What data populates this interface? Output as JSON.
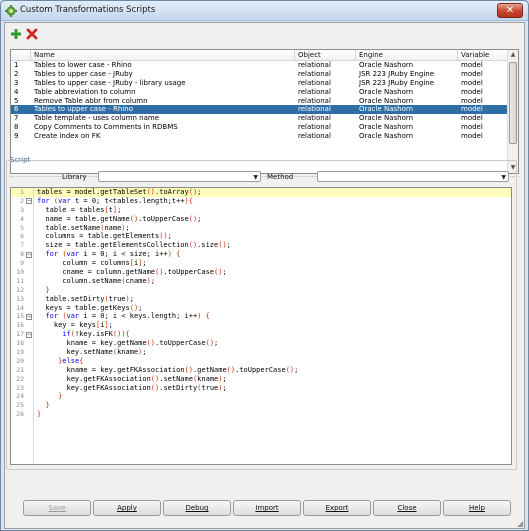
{
  "window": {
    "title": "Custom Transformations Scripts",
    "close_glyph": "✕"
  },
  "toolbar": {
    "add_icon": "plus-icon",
    "delete_icon": "x-icon",
    "add_color": "#2e9e2e",
    "delete_color": "#d2281e"
  },
  "table": {
    "columns": [
      "",
      "Name",
      "Object",
      "Engine",
      "Variable"
    ],
    "rows": [
      {
        "num": "1",
        "name": "Tables to lower case - Rhino",
        "object": "relational",
        "engine": "Oracle Nashorn",
        "variable": "model"
      },
      {
        "num": "2",
        "name": "Tables to upper case - JRuby",
        "object": "relational",
        "engine": "JSR 223 JRuby Engine",
        "variable": "model"
      },
      {
        "num": "3",
        "name": "Tables to upper case - JRuby - library usage",
        "object": "relational",
        "engine": "JSR 223 JRuby Engine",
        "variable": "model"
      },
      {
        "num": "4",
        "name": "Table abbreviation to column",
        "object": "relational",
        "engine": "Oracle Nashorn",
        "variable": "model"
      },
      {
        "num": "5",
        "name": "Remove Table abbr from column",
        "object": "relational",
        "engine": "Oracle Nashorn",
        "variable": "model"
      },
      {
        "num": "6",
        "name": "Tables to upper case - Rhino",
        "object": "relational",
        "engine": "Oracle Nashorn",
        "variable": "model",
        "selected": true
      },
      {
        "num": "7",
        "name": "Table template - uses column name",
        "object": "relational",
        "engine": "Oracle Nashorn",
        "variable": "model"
      },
      {
        "num": "8",
        "name": "Copy Comments to Comments in RDBMS",
        "object": "relational",
        "engine": "Oracle Nashorn",
        "variable": "model"
      },
      {
        "num": "9",
        "name": "Create index on FK",
        "object": "relational",
        "engine": "Oracle Nashorn",
        "variable": "model"
      }
    ],
    "selected_color": "#2f6ea5"
  },
  "script": {
    "group_label": "Script",
    "library_label": "Library",
    "library_value": "",
    "method_label": "Method",
    "method_value": ""
  },
  "editor": {
    "lines": [
      "tables = model.getTableSet().toArray();",
      "for (var t = 0; t<tables.length;t++){",
      "  table = tables[t];",
      "  name = table.getName().toUpperCase();",
      "  table.setName(name);",
      "  columns = table.getElements();",
      "  size = table.getElementsCollection().size();",
      "  for (var i = 0; i < size; i++) {",
      "      column = columns[i];",
      "      cname = column.getName().toUpperCase();",
      "      column.setName(cname);",
      "  }",
      "  table.setDirty(true);",
      "  keys = table.getKeys();",
      "  for (var i = 0; i < keys.length; i++) {",
      "    key = keys[i];",
      "      if(!key.isFK()){",
      "       kname = key.getName().toUpperCase();",
      "       key.setName(kname);",
      "     }else{",
      "       kname = key.getFKAssociation().getName().toUpperCase();",
      "       key.getFKAssociation().setName(kname);",
      "       key.getFKAssociation().setDirty(true);",
      "     }",
      "  }",
      "}"
    ],
    "fold_lines": [
      2,
      8,
      15,
      17
    ],
    "current_line": 1,
    "keyword_color": "#0000e6",
    "bracket_color": "#c83200",
    "highlight_color": "#fdfcb8"
  },
  "buttons": {
    "save": "Save",
    "apply": "Apply",
    "debug": "Debug",
    "import": "Import",
    "export": "Export",
    "close": "Close",
    "help": "Help"
  }
}
